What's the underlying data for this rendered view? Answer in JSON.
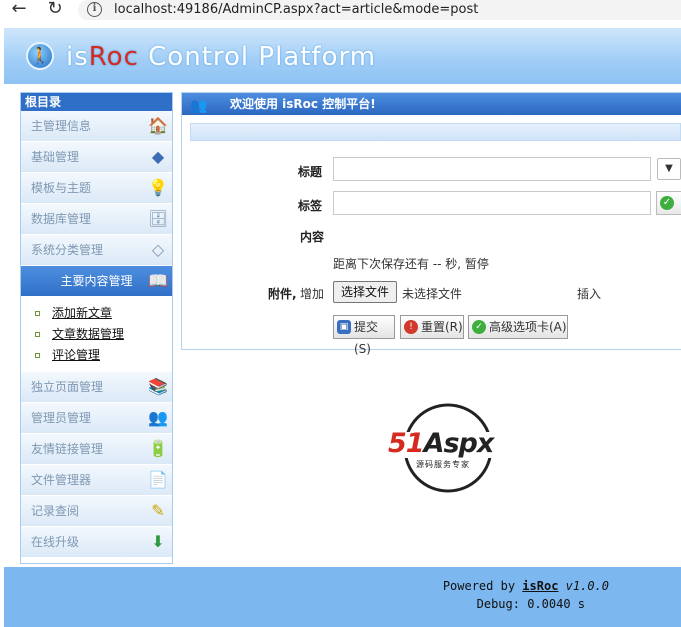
{
  "browser": {
    "back_icon": "←",
    "reload_icon": "↻",
    "url": "localhost:49186/AdminCP.aspx?act=article&mode=post"
  },
  "header": {
    "logo_is": "is",
    "logo_roc": "Roc",
    "logo_rest": " Control Platform"
  },
  "sidebar": {
    "title": "根目录",
    "items_top": [
      {
        "label": "主管理信息",
        "icon": "🏠"
      },
      {
        "label": "基础管理",
        "icon": "◆"
      },
      {
        "label": "模板与主题",
        "icon": "💡"
      },
      {
        "label": "数据库管理",
        "icon": "🗄"
      },
      {
        "label": "系统分类管理",
        "icon": "◇"
      }
    ],
    "active": {
      "label": "主要内容管理",
      "icon": "📖"
    },
    "sub_items": [
      "添加新文章",
      "文章数据管理",
      "评论管理"
    ],
    "items_bottom": [
      {
        "label": "独立页面管理",
        "icon": "📚"
      },
      {
        "label": "管理员管理",
        "icon": "👥"
      },
      {
        "label": "友情链接管理",
        "icon": "🔋"
      },
      {
        "label": "文件管理器",
        "icon": "📄"
      },
      {
        "label": "记录查阅",
        "icon": "✎"
      },
      {
        "label": "在线升级",
        "icon": "⬇"
      }
    ]
  },
  "panel": {
    "title": "欢迎使用 isRoc 控制平台!",
    "title_label": "标题",
    "title_value": "",
    "tag_label": "标签",
    "tag_value": "",
    "content_label": "内容",
    "autosave_text": "距离下次保存还有 -- 秒, 暂停",
    "attachment_label": "附件,",
    "attachment_add": "增加",
    "choose_file": "选择文件",
    "no_file": "未选择文件",
    "insert": "插入",
    "submit": "提交(S)",
    "reset": "重置(R)",
    "advanced": "高级选项卡(A)"
  },
  "brand": {
    "text_51": "51",
    "text_aspx": "Aspx",
    "tagline": "源码服务专家"
  },
  "footer": {
    "powered_prefix": "Powered by ",
    "powered_name": "isRoc",
    "powered_version": " v1.0.0",
    "debug": "Debug: 0.0040 s"
  },
  "colors": {
    "header_blue": "#8ec3f3",
    "sidebar_active": "#2f6fc7",
    "accent_red": "#d62a1e",
    "accent_green": "#3fae3f"
  }
}
